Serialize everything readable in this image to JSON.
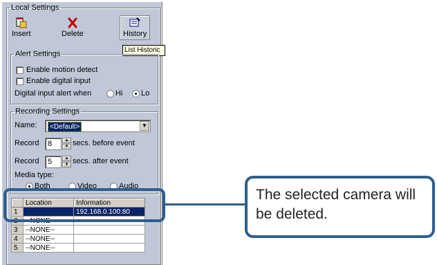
{
  "local_settings": {
    "legend": "Local Settings",
    "toolbar": {
      "insert": "Insert",
      "delete": "Delete",
      "history": "History"
    },
    "tooltip": "List Historic"
  },
  "alert_settings": {
    "legend": "Alert Settings",
    "enable_motion": "Enable motion detect",
    "enable_digital": "Enable digital input",
    "digital_alert_label": "Digital input alert when",
    "radio_hi": "Hi",
    "radio_lo": "Lo",
    "selected": "Lo"
  },
  "recording_settings": {
    "legend": "Recording Settings",
    "name_label": "Name:",
    "name_value": "<Default>",
    "record_before_label": "Record",
    "record_before_value": "8",
    "record_before_suffix": "secs. before event",
    "record_after_label": "Record",
    "record_after_value": "5",
    "record_after_suffix": "secs. after event",
    "media_label": "Media type:",
    "media_options": [
      "Both",
      "Video",
      "Audio"
    ],
    "media_selected": "Both"
  },
  "camera_table": {
    "headers": [
      "Location",
      "Information"
    ],
    "rows": [
      {
        "idx": "1",
        "location": "",
        "info": "192.168.0.100:80"
      },
      {
        "idx": "2",
        "location": "--NONE--",
        "info": ""
      },
      {
        "idx": "3",
        "location": "--NONE--",
        "info": ""
      },
      {
        "idx": "4",
        "location": "--NONE--",
        "info": ""
      },
      {
        "idx": "5",
        "location": "--NONE--",
        "info": ""
      }
    ]
  },
  "callout": {
    "text": "The selected camera will be deleted."
  },
  "colors": {
    "highlight": "#2f5e8f",
    "panel": "#c0c8d8",
    "selection": "#0a246a"
  }
}
